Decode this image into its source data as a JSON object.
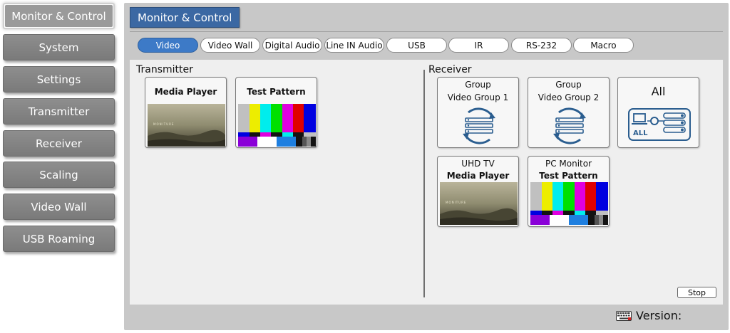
{
  "sidebar": {
    "items": [
      {
        "label": "Monitor & Control",
        "active": true
      },
      {
        "label": "System"
      },
      {
        "label": "Settings"
      },
      {
        "label": "Transmitter"
      },
      {
        "label": "Receiver"
      },
      {
        "label": "Scaling"
      },
      {
        "label": "Video Wall"
      },
      {
        "label": "USB Roaming"
      }
    ]
  },
  "main": {
    "title": "Monitor & Control",
    "tabs": [
      {
        "label": "Video",
        "active": true
      },
      {
        "label": "Video Wall"
      },
      {
        "label": "Digital Audio"
      },
      {
        "label": "Line IN Audio"
      },
      {
        "label": "USB"
      },
      {
        "label": "IR"
      },
      {
        "label": "RS-232"
      },
      {
        "label": "Macro"
      }
    ],
    "transmitter": {
      "label": "Transmitter",
      "cards": [
        {
          "title": "Media Player"
        },
        {
          "title": "Test Pattern"
        }
      ]
    },
    "receiver": {
      "label": "Receiver",
      "groups": [
        {
          "line1": "Group",
          "line2": "Video Group 1"
        },
        {
          "line1": "Group",
          "line2": "Video Group 2"
        }
      ],
      "all": {
        "label": "All",
        "icon_text": "ALL"
      },
      "devices": [
        {
          "name": "UHD TV",
          "source": "Media Player"
        },
        {
          "name": "PC Monitor",
          "source": "Test Pattern"
        }
      ]
    },
    "stop_label": "Stop",
    "thumb_text": "MONITURE"
  },
  "footer": {
    "version_label": "Version:"
  },
  "colors": {
    "title_bg": "#3b68a3",
    "tab_active": "#3d7ac7",
    "sidebar_btn": "#858585",
    "group_icon": "#2a5d8f"
  }
}
